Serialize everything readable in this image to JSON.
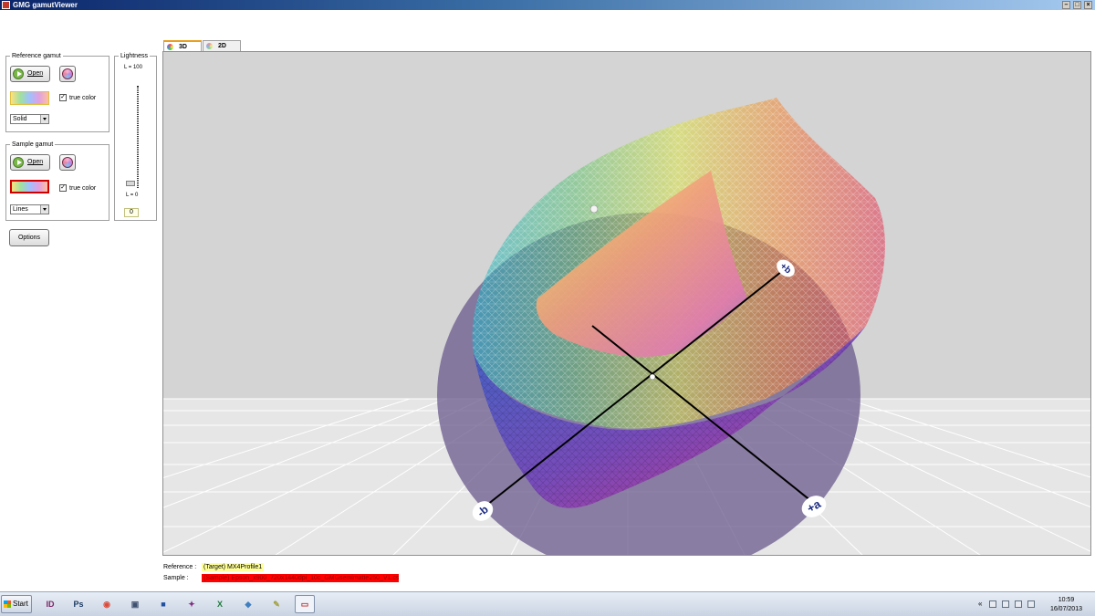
{
  "window": {
    "title": "GMG gamutViewer",
    "controls": {
      "minimize": "–",
      "maximize": "□",
      "close": "×"
    }
  },
  "reference_gamut": {
    "title": "Reference gamut",
    "open_label": "Open",
    "true_color_label": "true color",
    "true_color_checked": "✓",
    "render_mode": "Solid",
    "swatch_border_color": "#e0c040"
  },
  "sample_gamut": {
    "title": "Sample gamut",
    "open_label": "Open",
    "true_color_label": "true color",
    "true_color_checked": "✓",
    "render_mode": "Lines",
    "swatch_border_color": "#cc0000"
  },
  "options_label": "Options",
  "lightness": {
    "title": "Lightness",
    "max_label": "L = 100",
    "min_label": "L = 0",
    "value": "0"
  },
  "tabs": [
    {
      "label": "3D",
      "active": true
    },
    {
      "label": "2D",
      "active": false
    }
  ],
  "viewport": {
    "axis_labels": {
      "plus_b": "+b",
      "minus_b": "-b",
      "plus_a": "+a"
    }
  },
  "footer": {
    "reference_label": "Reference :",
    "reference_value": "(Target) MX4Profile1",
    "reference_bg": "#ffff99",
    "sample_label": "Sample :",
    "sample_value": "(Sample) Epson_x900_720x1440dpi_10c_GMGsemimatte250_V1.csv",
    "sample_bg": "#ff0000"
  },
  "taskbar": {
    "start_label": "Start",
    "apps": [
      {
        "icon": "indesign-icon",
        "text": "ID",
        "color": "#7d2667"
      },
      {
        "icon": "photoshop-icon",
        "text": "Ps",
        "color": "#1b3a63"
      },
      {
        "icon": "chrome-icon",
        "text": "◉",
        "color": "#dd4b39"
      },
      {
        "icon": "app-icon",
        "text": "▣",
        "color": "#405070"
      },
      {
        "icon": "floppy-icon",
        "text": "■",
        "color": "#2050a0"
      },
      {
        "icon": "gamut-icon",
        "text": "✦",
        "color": "#803080"
      },
      {
        "icon": "excel-icon",
        "text": "X",
        "color": "#1d7a3a"
      },
      {
        "icon": "eraser-icon",
        "text": "◆",
        "color": "#4080c0"
      },
      {
        "icon": "paint-icon",
        "text": "✎",
        "color": "#a0a040"
      },
      {
        "icon": "window-icon",
        "text": "▭",
        "color": "#c03030"
      }
    ],
    "tray_toggle": "«",
    "time": "10:59",
    "date": "16/07/2013"
  }
}
